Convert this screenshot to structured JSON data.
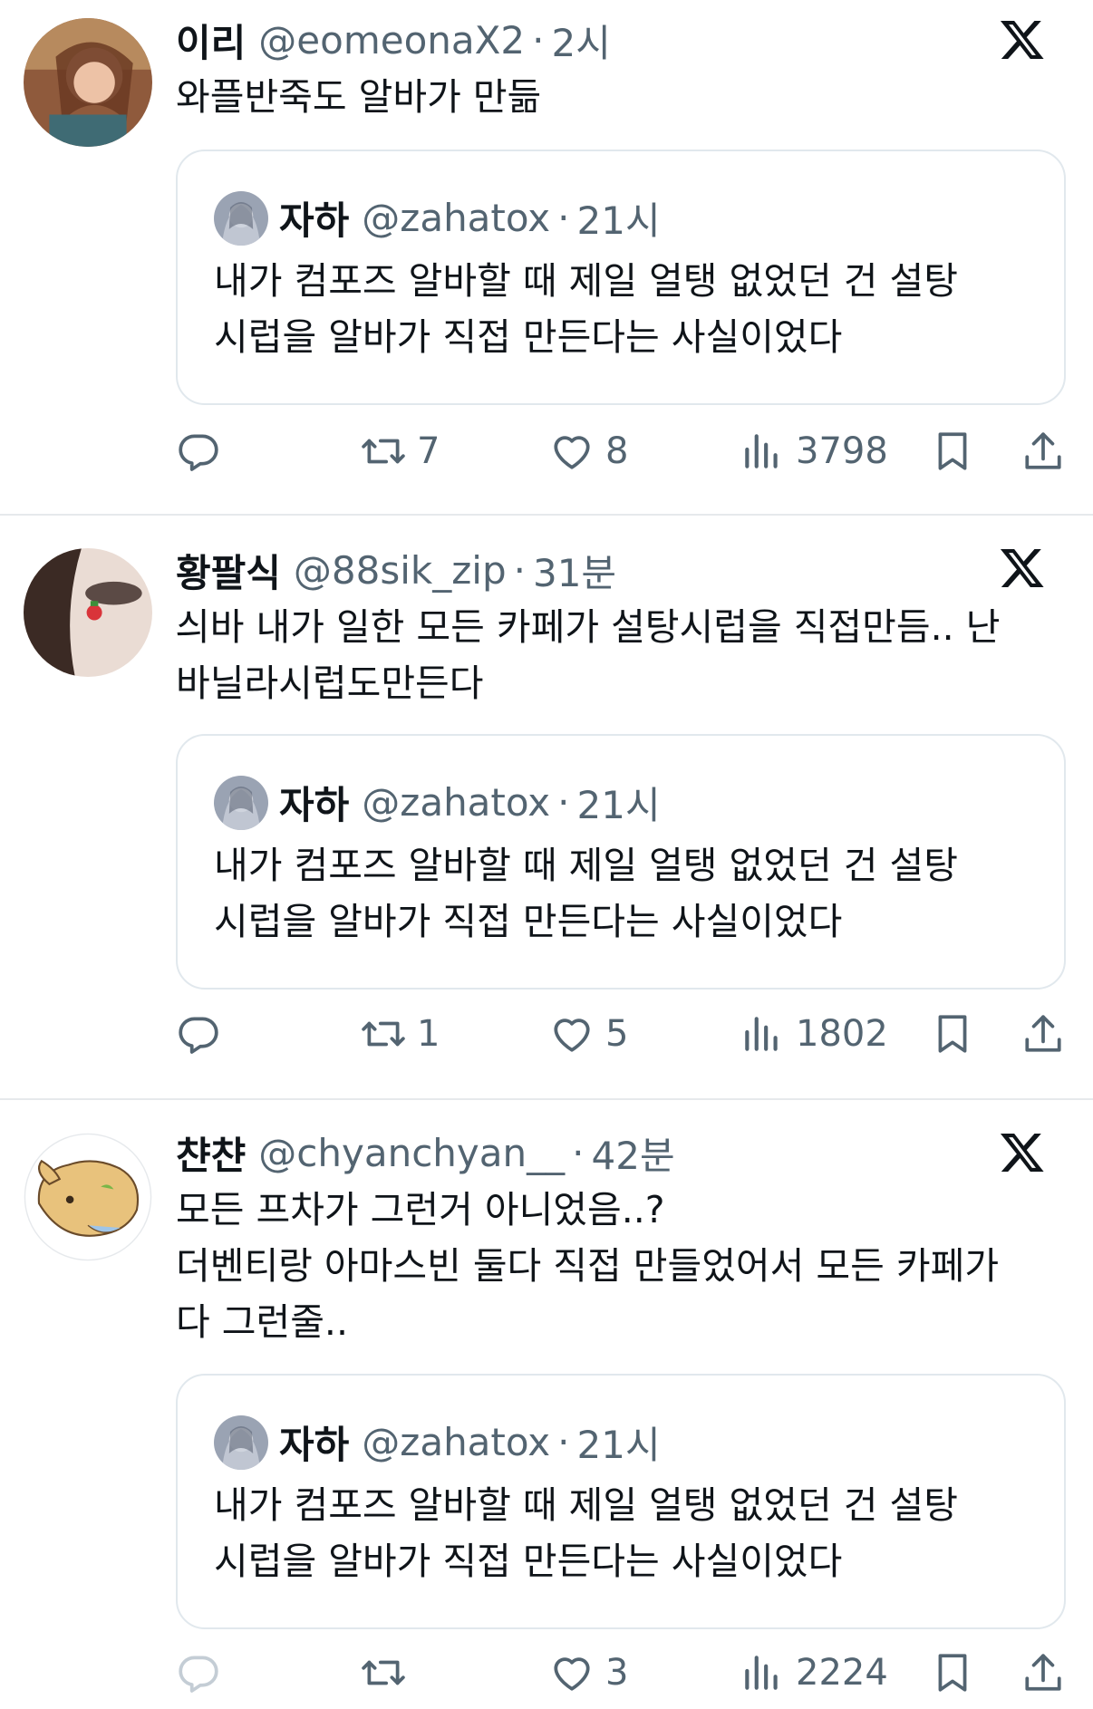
{
  "tweets": [
    {
      "name": "이리",
      "handle": "@eomeonaX2",
      "separator": "·",
      "time": "2시",
      "text_lines": [
        "와플반죽도 알바가 만듦"
      ],
      "quote": {
        "name": "자하",
        "handle": "@zahatox",
        "separator": "·",
        "time": "21시",
        "text_lines": [
          "내가 컴포즈 알바할 때 제일 얼탱 없었던 건 설탕",
          "시럽을 알바가 직접 만든다는 사실이었다"
        ]
      },
      "actions": {
        "reply": "",
        "retweet": "7",
        "like": "8",
        "views": "3798"
      }
    },
    {
      "name": "황팔식",
      "handle": "@88sik_zip",
      "separator": "·",
      "time": "31분",
      "text_lines": [
        "싀바 내가 일한 모든 카페가 설탕시럽을 직접만듬.. 난",
        "바닐라시럽도만든다"
      ],
      "quote": {
        "name": "자하",
        "handle": "@zahatox",
        "separator": "·",
        "time": "21시",
        "text_lines": [
          "내가 컴포즈 알바할 때 제일 얼탱 없었던 건 설탕",
          "시럽을 알바가 직접 만든다는 사실이었다"
        ]
      },
      "actions": {
        "reply": "",
        "retweet": "1",
        "like": "5",
        "views": "1802"
      }
    },
    {
      "name": "챤챤",
      "handle": "@chyanchyan__",
      "separator": "·",
      "time": "42분",
      "text_lines": [
        "모든 프차가 그런거 아니었음..?",
        "더벤티랑 아마스빈 둘다 직접 만들었어서 모든 카페가",
        "다 그런줄.."
      ],
      "quote": {
        "name": "자하",
        "handle": "@zahatox",
        "separator": "·",
        "time": "21시",
        "text_lines": [
          "내가 컴포즈 알바할 때 제일 얼탱 없었던 건 설탕",
          "시럽을 알바가 직접 만든다는 사실이었다"
        ]
      },
      "actions": {
        "reply": "",
        "retweet": "",
        "like": "3",
        "views": "2224"
      }
    }
  ],
  "colors": {
    "text": "#0f1419",
    "muted": "#536471",
    "border": "#e1e8ed"
  },
  "icons": [
    "x-logo-icon",
    "reply-icon",
    "retweet-icon",
    "like-icon",
    "views-icon",
    "bookmark-icon",
    "share-icon"
  ]
}
